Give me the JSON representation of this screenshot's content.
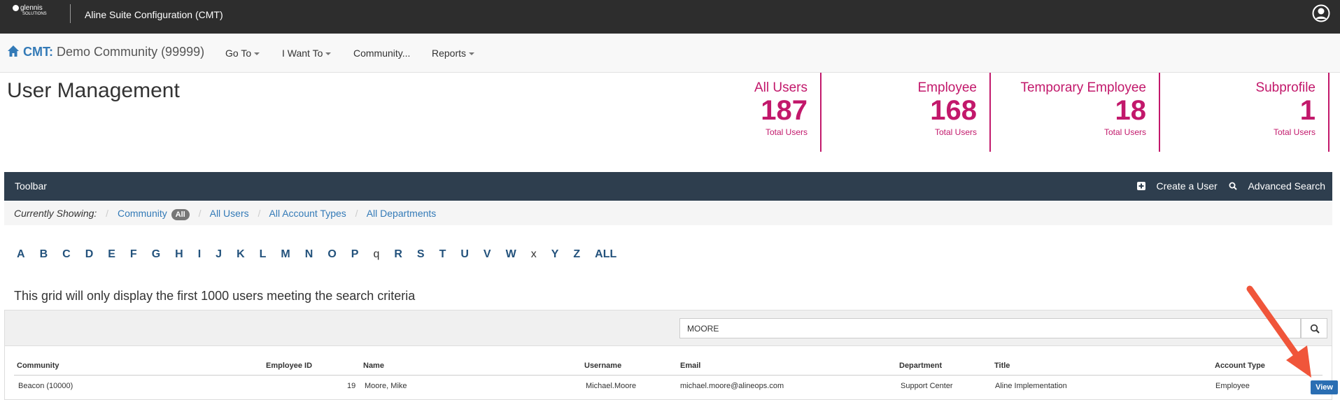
{
  "header": {
    "logo_text": "glennis",
    "logo_sub": "SOLUTIONS",
    "app_title": "Aline Suite Configuration (CMT)"
  },
  "nav": {
    "brand_prefix": "CMT:",
    "brand_community": "Demo Community (99999)",
    "items": [
      "Go To",
      "I Want To",
      "Community...",
      "Reports"
    ]
  },
  "page": {
    "title": "User Management"
  },
  "stats": [
    {
      "label": "All Users",
      "value": "187",
      "sub": "Total Users"
    },
    {
      "label": "Employee",
      "value": "168",
      "sub": "Total Users"
    },
    {
      "label": "Temporary Employee",
      "value": "18",
      "sub": "Total Users"
    },
    {
      "label": "Subprofile",
      "value": "1",
      "sub": "Total Users"
    }
  ],
  "toolbar": {
    "label": "Toolbar",
    "create_user": "Create a User",
    "advanced_search": "Advanced Search"
  },
  "filters": {
    "prefix": "Currently Showing:",
    "community": "Community",
    "community_badge": "All",
    "users": "All Users",
    "account_types": "All Account Types",
    "departments": "All Departments"
  },
  "alphabet": [
    "A",
    "B",
    "C",
    "D",
    "E",
    "F",
    "G",
    "H",
    "I",
    "J",
    "K",
    "L",
    "M",
    "N",
    "O",
    "P",
    "q",
    "R",
    "S",
    "T",
    "U",
    "V",
    "W",
    "x",
    "Y",
    "Z",
    "ALL"
  ],
  "grid": {
    "note": "This grid will only display the first 1000 users meeting the search criteria",
    "search_value": "MOORE",
    "columns": [
      "Community",
      "Employee ID",
      "Name",
      "Username",
      "Email",
      "Department",
      "Title",
      "Account Type"
    ],
    "rows": [
      {
        "community": "Beacon (10000)",
        "employee_id": "19",
        "name": "Moore, Mike",
        "username": "Michael.Moore",
        "email": "michael.moore@alineops.com",
        "department": "Support Center",
        "title": "Aline Implementation",
        "account_type": "Employee",
        "action": "View"
      }
    ]
  },
  "colors": {
    "accent": "#c2186b",
    "link": "#337ab7",
    "toolbar_bg": "#2e3e4e",
    "arrow": "#f0553a"
  }
}
